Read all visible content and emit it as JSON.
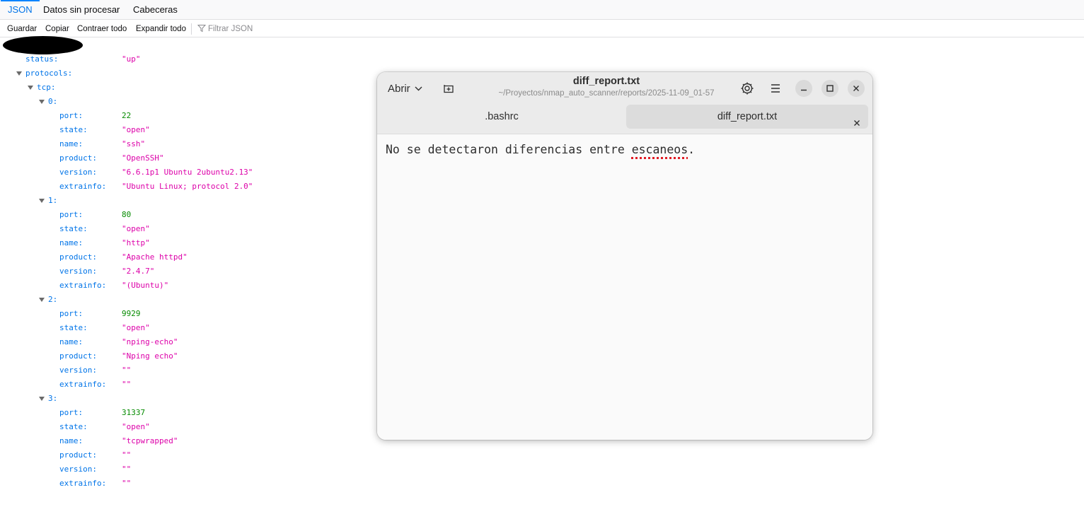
{
  "viewer": {
    "tabs": [
      "JSON",
      "Datos sin procesar",
      "Cabeceras"
    ],
    "toolbar": {
      "save": "Guardar",
      "copy": "Copiar",
      "collapse_all": "Contraer todo",
      "expand_all": "Expandir todo",
      "filter_placeholder": "Filtrar JSON"
    },
    "tree": {
      "status_key": "status:",
      "status_value": "\"up\"",
      "protocols_key": "protocols:",
      "tcp_key": "tcp:",
      "entries": [
        {
          "index": "0:",
          "port": "22",
          "state": "\"open\"",
          "name": "\"ssh\"",
          "product": "\"OpenSSH\"",
          "version": "\"6.6.1p1 Ubuntu 2ubuntu2.13\"",
          "extrainfo": "\"Ubuntu Linux; protocol 2.0\""
        },
        {
          "index": "1:",
          "port": "80",
          "state": "\"open\"",
          "name": "\"http\"",
          "product": "\"Apache httpd\"",
          "version": "\"2.4.7\"",
          "extrainfo": "\"(Ubuntu)\""
        },
        {
          "index": "2:",
          "port": "9929",
          "state": "\"open\"",
          "name": "\"nping-echo\"",
          "product": "\"Nping echo\"",
          "version": "\"\"",
          "extrainfo": "\"\""
        },
        {
          "index": "3:",
          "port": "31337",
          "state": "\"open\"",
          "name": "\"tcpwrapped\"",
          "product": "\"\"",
          "version": "\"\"",
          "extrainfo": "\"\""
        }
      ],
      "field_keys": {
        "port": "port:",
        "state": "state:",
        "name": "name:",
        "product": "product:",
        "version": "version:",
        "extrainfo": "extrainfo:"
      }
    }
  },
  "editor": {
    "open_label": "Abrir",
    "title": "diff_report.txt",
    "subtitle": "~/Proyectos/nmap_auto_scanner/reports/2025-11-09_01-57",
    "tabs": [
      ".bashrc",
      "diff_report.txt"
    ],
    "content_before": "No se detectaron diferencias entre ",
    "content_misspelled": "escaneos",
    "content_after": "."
  },
  "colors": {
    "json_key": "#0074e8",
    "json_string": "#dd00a9",
    "json_number": "#058b00",
    "spellcheck": "#e01b24"
  }
}
